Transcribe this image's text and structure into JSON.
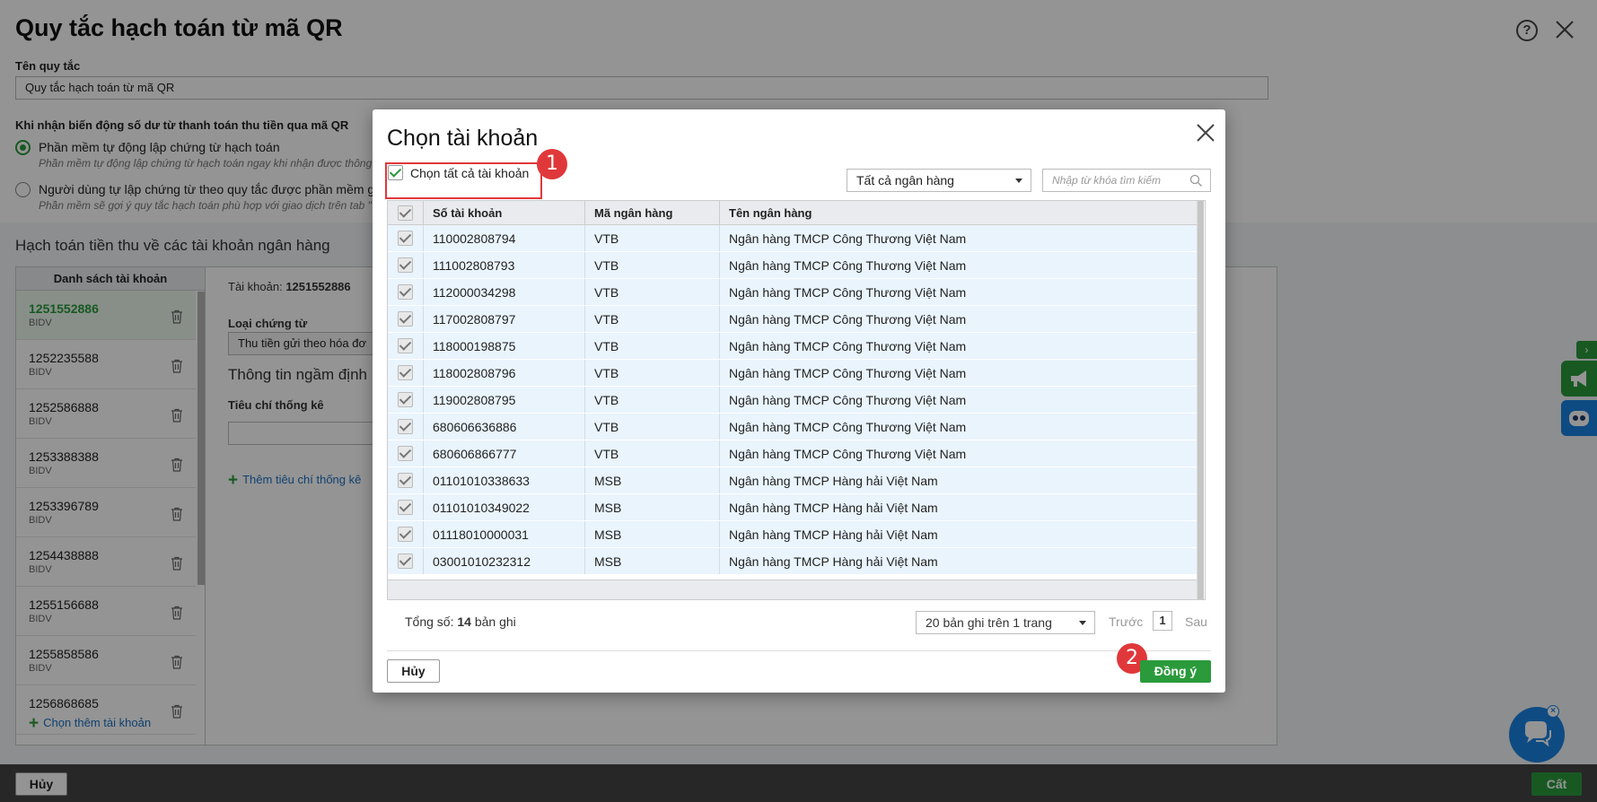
{
  "page": {
    "title": "Quy tắc hạch toán từ mã QR",
    "rule_name_label": "Tên quy tắc",
    "rule_name_value": "Quy tắc hạch toán từ mã QR",
    "when_label": "Khi nhận biến động số dư từ thanh toán thu tiền qua mã QR",
    "option1": "Phần mềm tự động lập chứng từ hạch toán",
    "option1_sub": "Phần mềm tự động lập chứng từ hạch toán ngay khi nhận được thông",
    "option2": "Người dùng tự lập chứng từ theo quy tắc được phần mềm gợ",
    "option2_sub": "Phần mềm sẽ gợi ý quy tắc hạch toán phù hợp với giao dịch trên tab \"",
    "section_title": "Hạch toán tiền thu về các tài khoản ngân hàng",
    "account_list_header": "Danh sách tài khoản",
    "accounts": [
      {
        "number": "1251552886",
        "bank": "BIDV"
      },
      {
        "number": "1252235588",
        "bank": "BIDV"
      },
      {
        "number": "1252586888",
        "bank": "BIDV"
      },
      {
        "number": "1253388388",
        "bank": "BIDV"
      },
      {
        "number": "1253396789",
        "bank": "BIDV"
      },
      {
        "number": "1254438888",
        "bank": "BIDV"
      },
      {
        "number": "1255156688",
        "bank": "BIDV"
      },
      {
        "number": "1255858586",
        "bank": "BIDV"
      },
      {
        "number": "1256868685",
        "bank": ""
      }
    ],
    "add_account": "Chọn thêm tài khoản",
    "detail": {
      "account_label": "Tài khoản:",
      "account_value": "1251552886",
      "doc_type_label": "Loại chứng từ",
      "doc_type_value": "Thu tiền gửi theo hóa đơ",
      "default_info": "Thông tin ngầm định",
      "criteria_label": "Tiêu chí thống kê",
      "add_criteria": "Thêm tiêu chí thống kê"
    },
    "footer_cancel": "Hủy",
    "footer_cut": "Cất"
  },
  "modal": {
    "title": "Chọn tài khoản",
    "select_all": "Chọn tất cả tài khoản",
    "select_all_checked": true,
    "bank_filter": "Tất cả ngân hàng",
    "search_placeholder": "Nhập từ khóa tìm kiếm",
    "columns": [
      "Số tài khoản",
      "Mã ngân hàng",
      "Tên ngân hàng"
    ],
    "rows": [
      [
        "110002808794",
        "VTB",
        "Ngân hàng TMCP Công Thương Việt Nam"
      ],
      [
        "111002808793",
        "VTB",
        "Ngân hàng TMCP Công Thương Việt Nam"
      ],
      [
        "112000034298",
        "VTB",
        "Ngân hàng TMCP Công Thương Việt Nam"
      ],
      [
        "117002808797",
        "VTB",
        "Ngân hàng TMCP Công Thương Việt Nam"
      ],
      [
        "118000198875",
        "VTB",
        "Ngân hàng TMCP Công Thương Việt Nam"
      ],
      [
        "118002808796",
        "VTB",
        "Ngân hàng TMCP Công Thương Việt Nam"
      ],
      [
        "119002808795",
        "VTB",
        "Ngân hàng TMCP Công Thương Việt Nam"
      ],
      [
        "680606636886",
        "VTB",
        "Ngân hàng TMCP Công Thương Việt Nam"
      ],
      [
        "680606866777",
        "VTB",
        "Ngân hàng TMCP Công Thương Việt Nam"
      ],
      [
        "01101010338633",
        "MSB",
        "Ngân hàng TMCP Hàng hải Việt Nam"
      ],
      [
        "01101010349022",
        "MSB",
        "Ngân hàng TMCP Hàng hải Việt Nam"
      ],
      [
        "01118010000031",
        "MSB",
        "Ngân hàng TMCP Hàng hải Việt Nam"
      ],
      [
        "03001010232312",
        "MSB",
        "Ngân hàng TMCP Hàng hải Việt Nam"
      ]
    ],
    "total_label": "Tổng số:",
    "total_count": "14",
    "total_suffix": "bản ghi",
    "per_page": "20 bản ghi trên 1 trang",
    "prev": "Trước",
    "page_number": "1",
    "next": "Sau",
    "cancel": "Hủy",
    "ok": "Đồng ý",
    "step_badges": [
      "1",
      "2"
    ]
  },
  "colors": {
    "accent": "#2a9a3b",
    "badge": "#e0383a",
    "row_bg": "#e9f4fd",
    "chat": "#1a82e2"
  }
}
